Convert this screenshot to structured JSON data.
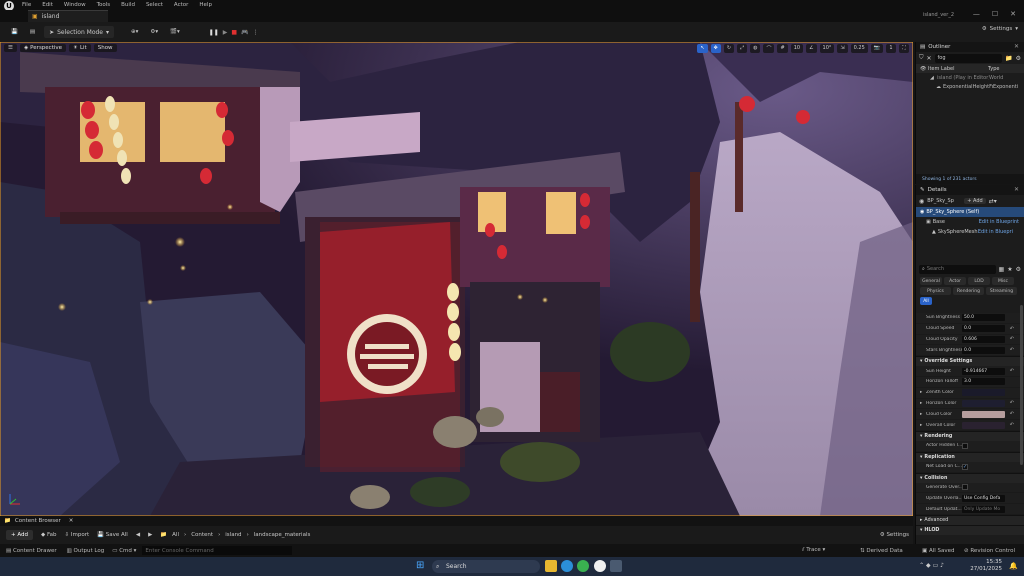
{
  "menu": {
    "items": [
      "File",
      "Edit",
      "Window",
      "Tools",
      "Build",
      "Select",
      "Actor",
      "Help"
    ]
  },
  "window": {
    "tab_label": "island",
    "project_title": "island_ver_2",
    "minimize": "—",
    "maximize": "☐",
    "close": "✕"
  },
  "toolbar": {
    "mode_label": "Selection Mode",
    "settings_label": "Settings"
  },
  "viewport": {
    "perspective_label": "Perspective",
    "lit_label": "Lit",
    "show_label": "Show",
    "snap_grid": "10",
    "snap_angle": "10°",
    "snap_scale": "0.25",
    "camera_speed": "1"
  },
  "outliner": {
    "title": "Outliner",
    "search_value": "fog",
    "col_label": "Item Label",
    "col_type": "Type",
    "rows": [
      {
        "label": "island (Play in Editor)",
        "type": "World"
      },
      {
        "label": "ExponentialHeightFog",
        "type": "Exponenti"
      }
    ],
    "status": "Showing 1 of 231 actors"
  },
  "details": {
    "title": "Details",
    "object_name": "BP_Sky_Sp",
    "add_label": "+ Add",
    "self_label": "BP_Sky_Sphere (Self)",
    "components": [
      {
        "label": "Base",
        "link": "Edit in Blueprint"
      },
      {
        "label": "SkySphereMesh",
        "link": "Edit in Bluepri"
      }
    ],
    "search_placeholder": "Search",
    "categories": [
      "General",
      "Actor",
      "LOD",
      "Misc",
      "Physics",
      "Rendering",
      "Streaming",
      "All"
    ],
    "props_top": [
      {
        "label": "Sun Brightness",
        "value": "50.0"
      },
      {
        "label": "Cloud Speed",
        "value": "0.0"
      },
      {
        "label": "Cloud Opacity",
        "value": "0.606"
      },
      {
        "label": "Stars Brightness",
        "value": "0.0"
      }
    ],
    "section_override": "Override Settings",
    "props_override": [
      {
        "label": "Sun Height",
        "value": "-0.914667"
      },
      {
        "label": "Horizon Falloff",
        "value": "3.0"
      }
    ],
    "color_props": [
      {
        "label": "Zenith Color",
        "color": "#1a1a2a"
      },
      {
        "label": "Horizon Color",
        "color": "#1e1e30"
      },
      {
        "label": "Cloud Color",
        "color": "#b59d9d"
      },
      {
        "label": "Overall Color",
        "color": "#2a2230"
      }
    ],
    "section_rendering": "Rendering",
    "rendering_prop": "Actor Hidden I...",
    "section_replication": "Replication",
    "replication_prop": "Net Load on C...",
    "section_collision": "Collision",
    "collision_props": [
      {
        "label": "Generate Over...",
        "value": ""
      },
      {
        "label": "Update Overla...",
        "value": "Use Config Defa"
      },
      {
        "label": "Default Updat...",
        "value": "Only Update Mo"
      }
    ],
    "section_advanced": "Advanced",
    "section_hlod": "HLOD"
  },
  "content_browser": {
    "tab_label": "Content Browser",
    "add_label": "+ Add",
    "fab_label": "Fab",
    "import_label": "Import",
    "save_all_label": "Save All",
    "breadcrumb": [
      "All",
      "Content",
      "island",
      "landscape_materials"
    ],
    "settings_label": "Settings"
  },
  "statusbar": {
    "content_drawer": "Content Drawer",
    "output_log": "Output Log",
    "cmd": "Cmd",
    "console_placeholder": "Enter Console Command",
    "trace": "Trace",
    "derived_data": "Derived Data",
    "all_saved": "All Saved",
    "revision_control": "Revision Control"
  },
  "taskbar": {
    "search_label": "Search",
    "time": "15:35",
    "date": "27/01/2025"
  }
}
